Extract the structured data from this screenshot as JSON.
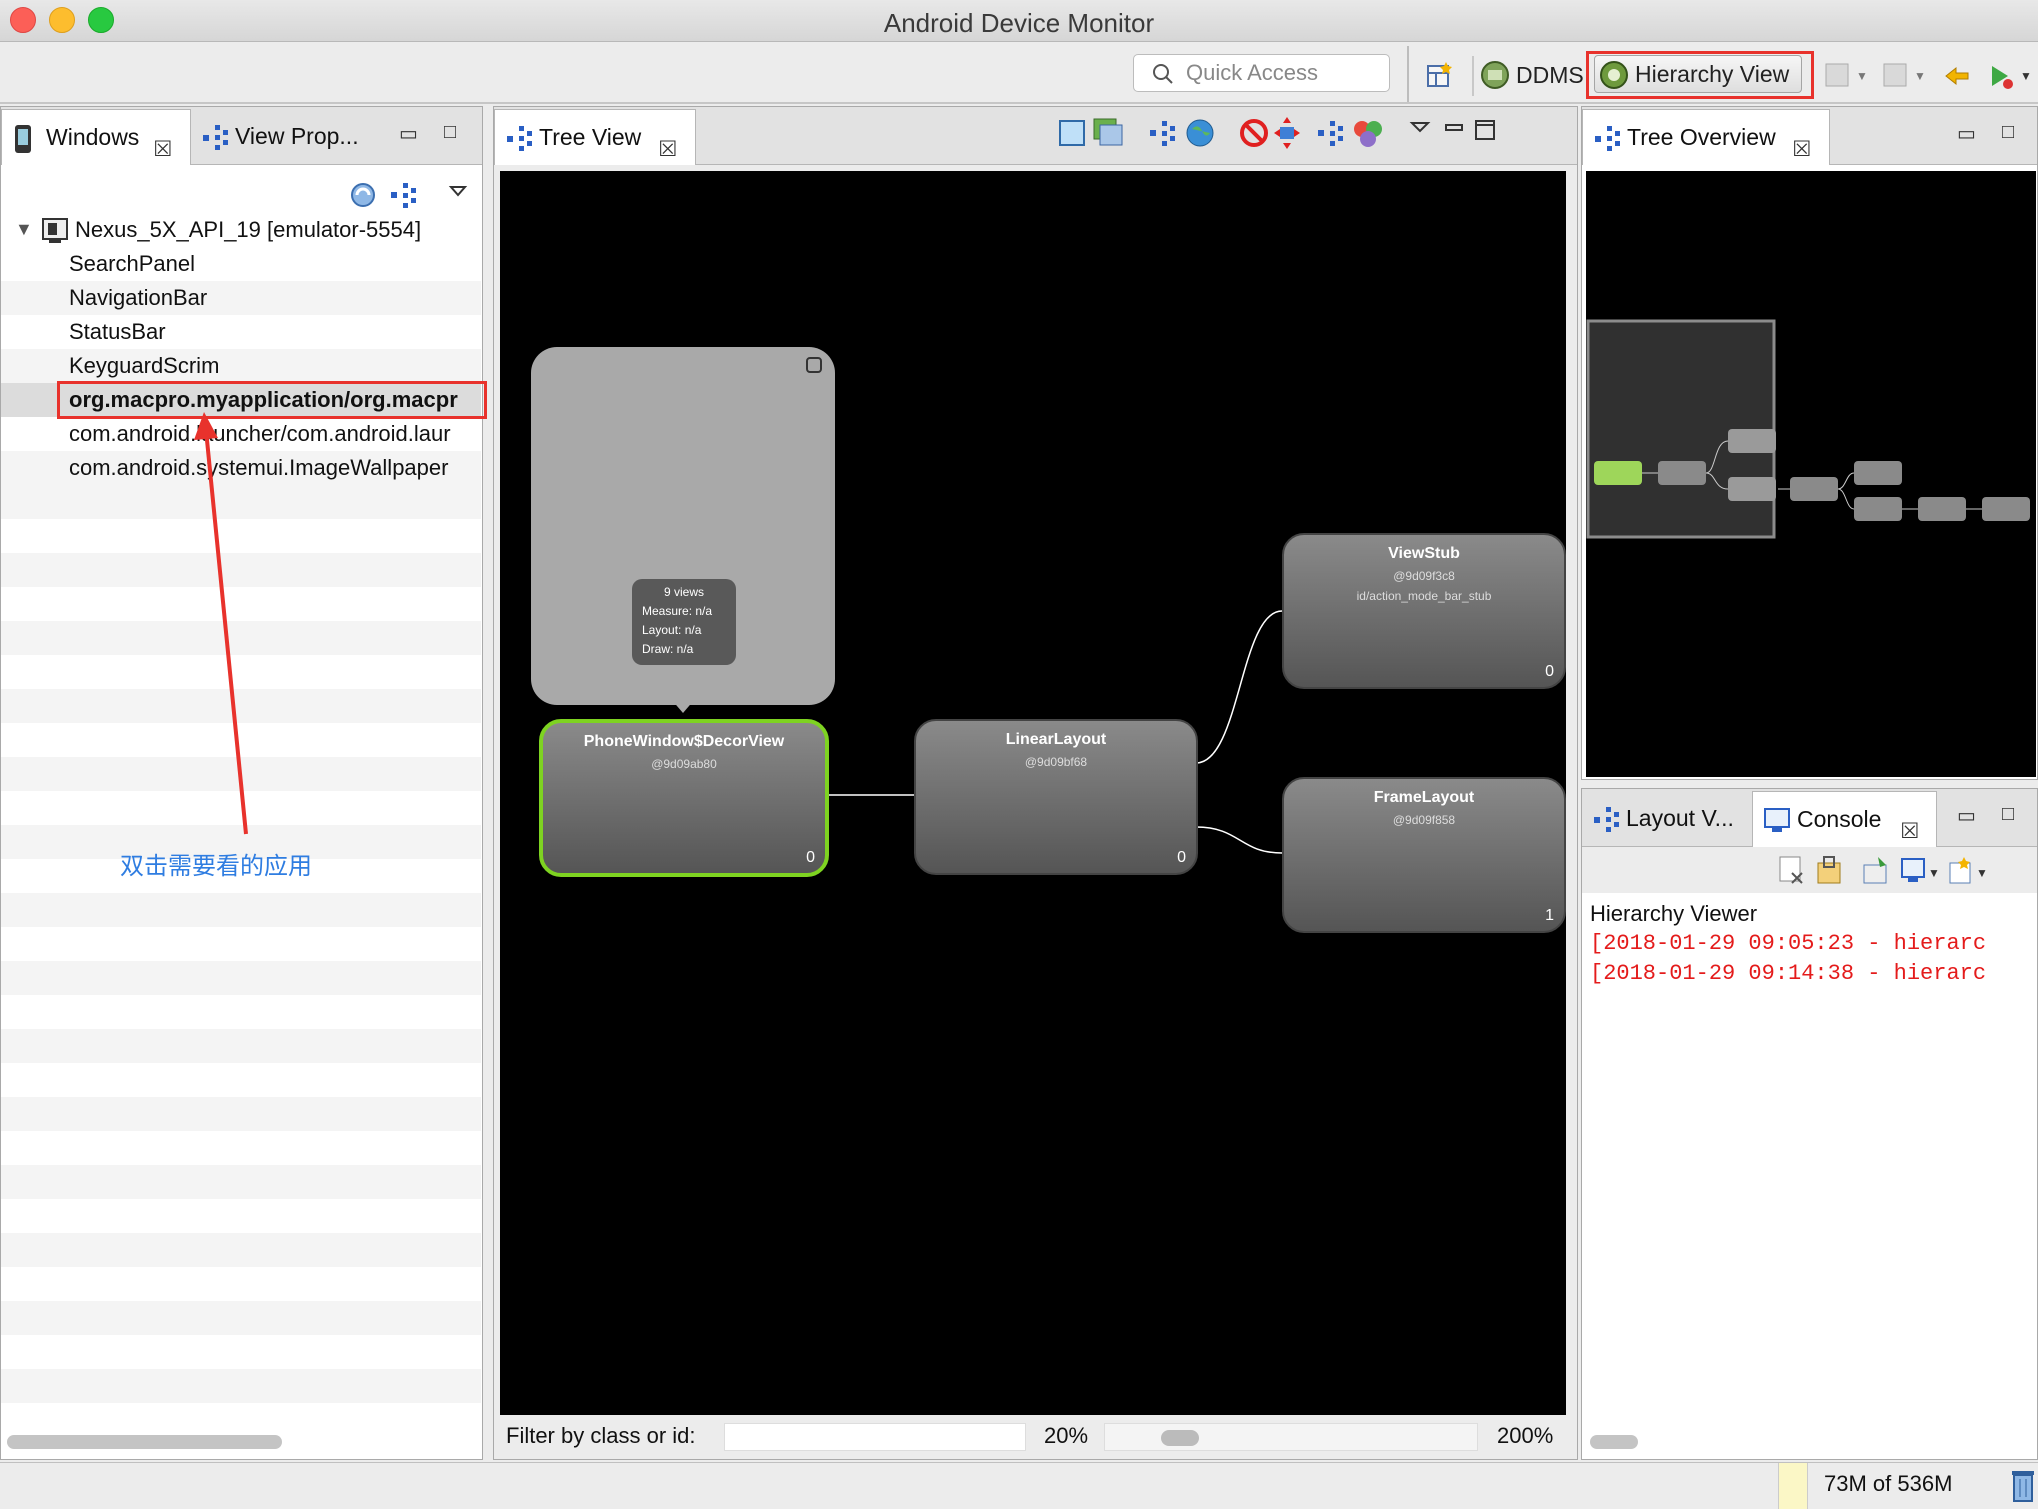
{
  "window": {
    "title": "Android Device Monitor"
  },
  "toolbar": {
    "quick_access_placeholder": "Quick Access",
    "perspectives": [
      {
        "label": "DDMS",
        "icon": "ddms-icon"
      },
      {
        "label": "Hierarchy View",
        "icon": "hierarchy-view-icon",
        "active": true
      }
    ]
  },
  "windows_panel": {
    "tabs": [
      {
        "label": "Windows",
        "active": true
      },
      {
        "label": "View Prop..."
      }
    ],
    "device": "Nexus_5X_API_19 [emulator-5554]",
    "items": [
      "SearchPanel",
      "NavigationBar",
      "StatusBar",
      "KeyguardScrim",
      "org.macpro.myapplication/org.macpr",
      "com.android.launcher/com.android.laur",
      "com.android.systemui.ImageWallpaper"
    ],
    "selected_index": 4,
    "annotation": "双击需要看的应用"
  },
  "tree_view": {
    "tab": "Tree View",
    "tooltip": {
      "views": "9 views",
      "measure": "Measure: n/a",
      "layout": "Layout: n/a",
      "draw": "Draw: n/a"
    },
    "nodes": [
      {
        "name": "PhoneWindow$DecorView",
        "id": "@9d09ab80",
        "extra": "",
        "count": "0",
        "selected": true
      },
      {
        "name": "LinearLayout",
        "id": "@9d09bf68",
        "extra": "",
        "count": "0"
      },
      {
        "name": "ViewStub",
        "id": "@9d09f3c8",
        "extra": "id/action_mode_bar_stub",
        "count": "0"
      },
      {
        "name": "FrameLayout",
        "id": "@9d09f858",
        "extra": "",
        "count": "1"
      }
    ],
    "filter_label": "Filter by class or id:",
    "zoom_min": "20%",
    "zoom_max": "200%",
    "zoom_level": 0.15
  },
  "tree_overview": {
    "tab": "Tree Overview"
  },
  "console_panel": {
    "tabs": [
      {
        "label": "Layout V..."
      },
      {
        "label": "Console",
        "active": true
      }
    ],
    "title": "Hierarchy Viewer",
    "lines": [
      "[2018-01-29 09:05:23 - hierarc",
      "[2018-01-29 09:14:38 - hierarc"
    ]
  },
  "status": {
    "memory": "73M of 536M"
  },
  "colors": {
    "highlight_red": "#e8322c",
    "selected_green": "#7ed321",
    "annotation_blue": "#2f7de1",
    "console_red": "#e41b1b"
  }
}
